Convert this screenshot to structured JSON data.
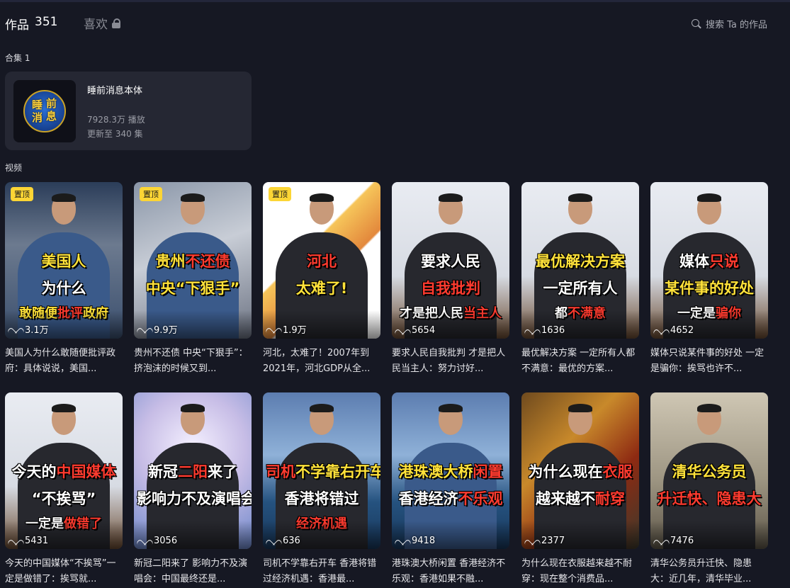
{
  "tabs": {
    "works_label": "作品",
    "works_count": "351",
    "likes_label": "喜欢"
  },
  "search": {
    "placeholder": "搜索 Ta 的作品"
  },
  "collections": {
    "label": "合集 1",
    "item": {
      "title": "睡前消息本体",
      "plays": "7928.3万 播放",
      "update": "更新至 340 集",
      "cover_text": [
        "睡",
        "前",
        "消",
        "息"
      ]
    }
  },
  "videos_label": "视频",
  "pin_label": "置顶",
  "videos": [
    {
      "likes": "3.1万",
      "pinned": true,
      "bg": "news",
      "blue": true,
      "lines": [
        [
          [
            "美国人",
            "y"
          ]
        ],
        [
          [
            "为什么",
            "w"
          ]
        ],
        [
          [
            "敢随便",
            "y"
          ],
          [
            "批评",
            "r"
          ],
          [
            "政府",
            "y"
          ]
        ]
      ],
      "title": "美国人为什么敢随便批评政府：具体说说，美国..."
    },
    {
      "likes": "9.9万",
      "pinned": true,
      "bg": "office",
      "blue": true,
      "lines": [
        [
          [
            "贵州",
            "y"
          ],
          [
            "不还债",
            "r"
          ]
        ],
        [
          [
            "中央“下狠手”",
            "y"
          ]
        ],
        []
      ],
      "title": "贵州不还债 中央“下狠手”：挤泡沫的时候又到..."
    },
    {
      "likes": "1.9万",
      "pinned": true,
      "bg": "map",
      "blue": false,
      "lines": [
        [
          [
            "河北",
            "r"
          ]
        ],
        [
          [
            "太难了!",
            "y"
          ]
        ],
        []
      ],
      "title": "河北，太难了！2007年到2021年，河北GDP从全..."
    },
    {
      "likes": "5654",
      "pinned": false,
      "bg": "screen",
      "blue": false,
      "lines": [
        [
          [
            "要求人民",
            "w"
          ]
        ],
        [
          [
            "自我批判",
            "r"
          ]
        ],
        [
          [
            "才是把人民",
            "w"
          ],
          [
            "当主人",
            "r"
          ]
        ]
      ],
      "title": "要求人民自我批判 才是把人民当主人：努力讨好..."
    },
    {
      "likes": "1636",
      "pinned": false,
      "bg": "screen",
      "blue": false,
      "lines": [
        [
          [
            "最优解决方案",
            "y"
          ]
        ],
        [
          [
            "一定所有人",
            "w"
          ]
        ],
        [
          [
            "都",
            "w"
          ],
          [
            "不满意",
            "r"
          ]
        ]
      ],
      "title": "最优解决方案 一定所有人都不满意：最优的方案..."
    },
    {
      "likes": "4652",
      "pinned": false,
      "bg": "screen",
      "blue": false,
      "lines": [
        [
          [
            "媒体",
            "w"
          ],
          [
            "只说",
            "r"
          ]
        ],
        [
          [
            "某件事的好处",
            "y"
          ]
        ],
        [
          [
            "一定是",
            "w"
          ],
          [
            "骗你",
            "r"
          ]
        ]
      ],
      "title": "媒体只说某件事的好处 一定是骗你：挨骂也许不..."
    },
    {
      "likes": "5431",
      "pinned": false,
      "bg": "screen",
      "blue": false,
      "lines": [
        [
          [
            "今天的",
            "w"
          ],
          [
            "中国媒体",
            "r"
          ]
        ],
        [
          [
            "“不挨骂”",
            "w"
          ]
        ],
        [
          [
            "一定是",
            "w"
          ],
          [
            "做错了",
            "r"
          ]
        ]
      ],
      "title": "今天的中国媒体“不挨骂”一定是做错了：挨骂就..."
    },
    {
      "likes": "3056",
      "pinned": false,
      "bg": "crowd",
      "blue": false,
      "lines": [
        [
          [
            "新冠",
            "w"
          ],
          [
            "二阳",
            "r"
          ],
          [
            "来了",
            "w"
          ]
        ],
        [
          [
            "影响力不及演唱会",
            "w"
          ]
        ],
        []
      ],
      "title": "新冠二阳来了 影响力不及演唱会：中国最终还是..."
    },
    {
      "likes": "636",
      "pinned": false,
      "bg": "bridge",
      "blue": false,
      "lines": [
        [
          [
            "司机",
            "r"
          ],
          [
            "不学靠右开车",
            "y"
          ]
        ],
        [
          [
            "香港将错过",
            "w"
          ]
        ],
        [
          [
            "经济机遇",
            "r"
          ]
        ]
      ],
      "title": "司机不学靠右开车 香港将错过经济机遇：香港最..."
    },
    {
      "likes": "9418",
      "pinned": false,
      "bg": "bridge",
      "blue": true,
      "lines": [
        [
          [
            "港珠澳大桥",
            "y"
          ],
          [
            "闲置",
            "r"
          ]
        ],
        [
          [
            "香港经济",
            "w"
          ],
          [
            "不乐观",
            "r"
          ]
        ],
        []
      ],
      "title": "港珠澳大桥闲置 香港经济不乐观：香港如果不融..."
    },
    {
      "likes": "2377",
      "pinned": false,
      "bg": "autumn",
      "blue": false,
      "lines": [
        [
          [
            "为什么现在",
            "w"
          ],
          [
            "衣服",
            "r"
          ]
        ],
        [
          [
            "越来越不",
            "w"
          ],
          [
            "耐穿",
            "r"
          ]
        ],
        []
      ],
      "title": "为什么现在衣服越来越不耐穿：现在整个消费品..."
    },
    {
      "likes": "7476",
      "pinned": false,
      "bg": "gate",
      "blue": false,
      "lines": [
        [
          [
            "清华公务员",
            "y"
          ]
        ],
        [
          [
            "升迁快、隐患大",
            "r"
          ]
        ],
        []
      ],
      "title": "清华公务员升迁快、隐患大：近几年，清华毕业..."
    }
  ]
}
